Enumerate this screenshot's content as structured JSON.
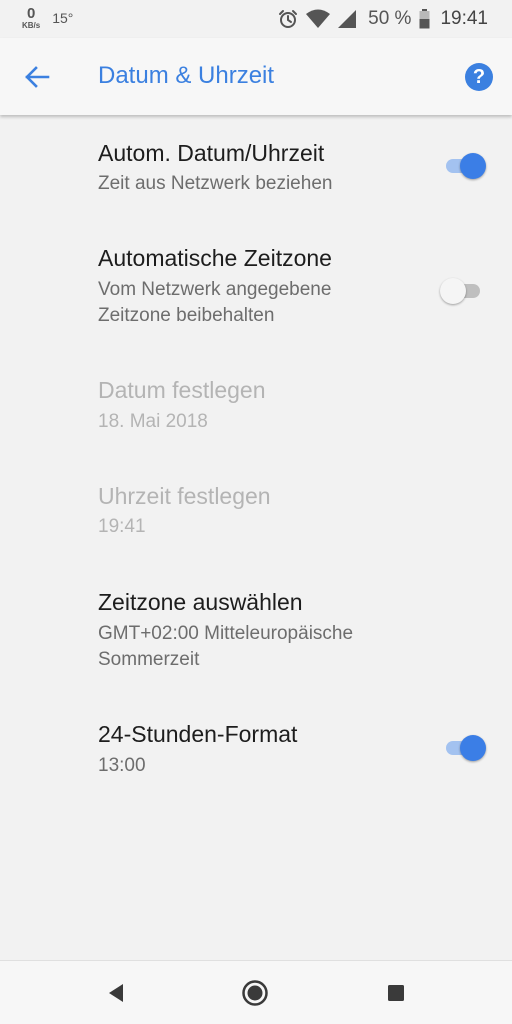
{
  "status_bar": {
    "net_speed_value": "0",
    "net_speed_unit": "KB/s",
    "temperature": "15°",
    "icons": [
      "alarm-icon",
      "wifi-icon",
      "signal-icon",
      "battery-icon"
    ],
    "battery": "50 %",
    "time": "19:41"
  },
  "app_bar": {
    "back_icon": "arrow-back-icon",
    "title": "Datum & Uhrzeit",
    "help_icon": "help-icon",
    "help_glyph": "?"
  },
  "settings": {
    "auto_datetime": {
      "title": "Autom. Datum/Uhrzeit",
      "summary": "Zeit aus Netzwerk beziehen",
      "toggle": "on"
    },
    "auto_timezone": {
      "title": "Automatische Zeitzone",
      "summary": "Vom Netzwerk angegebene Zeitzone beibehalten",
      "toggle": "off"
    },
    "set_date": {
      "title": "Datum festlegen",
      "summary": "18. Mai 2018",
      "enabled": false
    },
    "set_time": {
      "title": "Uhrzeit festlegen",
      "summary": "19:41",
      "enabled": false
    },
    "select_timezone": {
      "title": "Zeitzone auswählen",
      "summary": "GMT+02:00 Mitteleuropäische Sommerzeit"
    },
    "format_24h": {
      "title": "24-Stunden-Format",
      "summary": "13:00",
      "toggle": "on"
    }
  },
  "nav_bar": {
    "icons": [
      "back-triangle-icon",
      "home-circle-icon",
      "recents-square-icon"
    ]
  },
  "colors": {
    "accent": "#3b80e0",
    "background": "#f2f2f2",
    "disabled_text": "#b4b4b4"
  }
}
